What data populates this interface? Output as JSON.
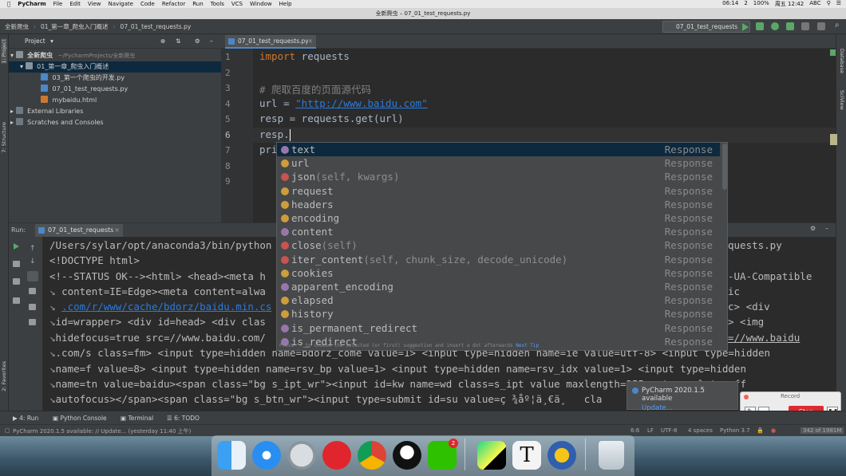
{
  "menubar": {
    "app": "PyCharm",
    "items": [
      "File",
      "Edit",
      "View",
      "Navigate",
      "Code",
      "Refactor",
      "Run",
      "Tools",
      "VCS",
      "Window",
      "Help"
    ],
    "right_items": [
      "06:14",
      "2",
      "100%",
      "周五 12:42",
      "ABC"
    ]
  },
  "window_title": "全新爬虫 – 07_01_test_requests.py",
  "navbar": {
    "crumbs": [
      "全新爬虫",
      "01_第一章_爬虫入门概述",
      "07_01_test_requests.py"
    ],
    "run_config": "07_01_test_requests"
  },
  "left_strip": {
    "project": "1: Project",
    "structure": "7: Structure",
    "favorites": "2: Favorites"
  },
  "right_strip": {
    "database": "Database",
    "sciview": "SciView"
  },
  "project_panel": {
    "title": "Project",
    "root": "全新爬虫",
    "root_path": "~/PycharmProjects/全新爬虫",
    "folder": "01_第一章_爬虫入门概述",
    "files": [
      "03_第一个爬虫的开发.py",
      "07_01_test_requests.py",
      "mybaidu.html"
    ],
    "external": "External Libraries",
    "scratches": "Scratches and Consoles"
  },
  "editor": {
    "tab": "07_01_test_requests.py",
    "line_numbers": [
      "1",
      "2",
      "3",
      "4",
      "5",
      "6",
      "7",
      "8",
      "9"
    ],
    "line1_kw": "import",
    "line1_rest": " requests",
    "line3_comment": "# 爬取百度的页面源代码",
    "line4_a": "url = ",
    "line4_url": "\"http://www.baidu.com\"",
    "line5": "resp = requests.get(url)",
    "line6": "resp.",
    "line7": "pri"
  },
  "completion": {
    "items": [
      {
        "name": "text",
        "sig": "",
        "type": "Response",
        "color": "#9876aa"
      },
      {
        "name": "url",
        "sig": "",
        "type": "Response",
        "color": "#cc9d3a"
      },
      {
        "name": "json",
        "sig": "(self, kwargs)",
        "type": "Response",
        "color": "#c75450"
      },
      {
        "name": "request",
        "sig": "",
        "type": "Response",
        "color": "#cc9d3a"
      },
      {
        "name": "headers",
        "sig": "",
        "type": "Response",
        "color": "#cc9d3a"
      },
      {
        "name": "encoding",
        "sig": "",
        "type": "Response",
        "color": "#cc9d3a"
      },
      {
        "name": "content",
        "sig": "",
        "type": "Response",
        "color": "#9876aa"
      },
      {
        "name": "close",
        "sig": "(self)",
        "type": "Response",
        "color": "#c75450"
      },
      {
        "name": "iter_content",
        "sig": "(self, chunk_size, decode_unicode)",
        "type": "Response",
        "color": "#c75450"
      },
      {
        "name": "cookies",
        "sig": "",
        "type": "Response",
        "color": "#cc9d3a"
      },
      {
        "name": "apparent_encoding",
        "sig": "",
        "type": "Response",
        "color": "#9876aa"
      },
      {
        "name": "elapsed",
        "sig": "",
        "type": "Response",
        "color": "#cc9d3a"
      },
      {
        "name": "history",
        "sig": "",
        "type": "Response",
        "color": "#cc9d3a"
      },
      {
        "name": "is_permanent_redirect",
        "sig": "",
        "type": "Response",
        "color": "#9876aa"
      },
      {
        "name": "is_redirect",
        "sig": "",
        "type": "Response",
        "color": "#9876aa"
      }
    ],
    "footer": "Press ^. to choose the selected (or first) suggestion and insert a dot afterwards",
    "footer_link": "Next Tip"
  },
  "run_panel": {
    "label": "Run:",
    "tab": "07_01_test_requests",
    "lines": [
      "/Users/sylar/opt/anaconda3/bin/python",
      "<!DOCTYPE html>",
      "<!--STATUS OK--><html> <head><meta h",
      "content=IE=Edge><meta content=alwa",
      ".com/r/www/cache/bdorz/baidu.min.cs",
      "id=wrapper> <div id=head> <div clas",
      "hidefocus=true src=//www.baidu.com/",
      ".com/s class=fm> <input type=hidden name=bdorz_come value=1> <input type=hidden name=ie value=utf-8> <input type=hidden",
      "name=f value=8> <input type=hidden name=rsv_bp value=1> <input type=hidden name=rsv_idx value=1> <input type=hidden",
      "name=tn value=baidu><span class=\"bg s_ipt_wr\"><input id=kw name=wd class=s_ipt value maxlength=255 autocomplete=off",
      "autofocus></span><span class=\"bg s_btn_wr\"><input type=submit id=su value=ç ¾åº¦ä¸€ä¸   cla"
    ],
    "right_fragments": [
      "quests.py",
      "-UA-Compatible",
      "ic",
      "c> <div",
      "> <img",
      "=//www.baidu"
    ]
  },
  "notification": {
    "title": "PyCharm 2020.1.5 available",
    "link": "Update..."
  },
  "recorder": {
    "title": "Record",
    "stop": "Stop"
  },
  "bottom_tabs": [
    "4: Run",
    "Python Console",
    "Terminal",
    "6: TODO"
  ],
  "status": {
    "message": "PyCharm 2020.1.5 available: // Update... (yesterday 11:40 上午)",
    "position": "6:6",
    "line_sep": "LF",
    "encoding": "UTF-8",
    "indent": "4 spaces",
    "interpreter": "Python 3.7",
    "memory": "342 of 1981M"
  },
  "colors": {
    "accent": "#4a88c7",
    "selection": "#0d293e",
    "stop": "#e0292f"
  }
}
